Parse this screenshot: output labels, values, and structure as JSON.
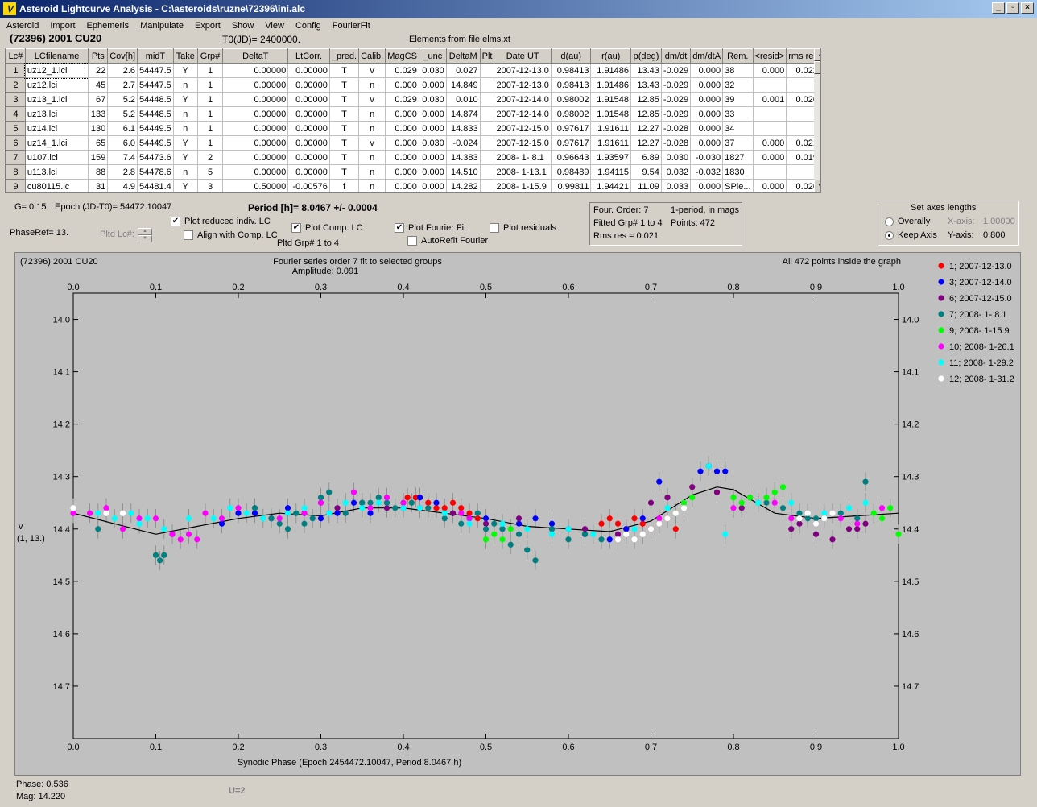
{
  "window": {
    "title": "Asteroid Lightcurve Analysis - C:\\asteroids\\ruzne\\72396\\ini.alc",
    "icon": "app-icon",
    "buttons": [
      "_",
      "▫",
      "×"
    ]
  },
  "menu": [
    "Asteroid",
    "Import",
    "Ephemeris",
    "Manipulate",
    "Export",
    "Show",
    "View",
    "Config",
    "FourierFit"
  ],
  "header": {
    "asteroid": "(72396) 2001 CU20",
    "t0": "T0(JD)= 2400000.",
    "elements": "Elements from file elms.xt"
  },
  "table": {
    "columns": [
      "Lc#",
      "LCfilename",
      "Pts",
      "Cov[h]",
      "midT",
      "Take",
      "Grp#",
      "DeltaT",
      "LtCorr.",
      "_pred.",
      "Calib.",
      "MagCS",
      "_unc",
      "DeltaM",
      "Plt",
      "Date UT",
      "d(au)",
      "r(au)",
      "p(deg)",
      "dm/dt",
      "dm/dtA",
      "Rem.",
      "<resid>",
      "rms res"
    ],
    "rows": [
      [
        "1",
        "uz12_1.lci",
        "22",
        "2.6",
        "54447.5",
        "Y",
        "1",
        "0.00000",
        "0.00000",
        "T",
        "v",
        "0.029",
        "0.030",
        "0.027",
        "",
        "2007-12-13.0",
        "0.98413",
        "1.91486",
        "13.43",
        "-0.029",
        "0.000",
        "38",
        "0.000",
        "0.022"
      ],
      [
        "2",
        "uz12.lci",
        "45",
        "2.7",
        "54447.5",
        "n",
        "1",
        "0.00000",
        "0.00000",
        "T",
        "n",
        "0.000",
        "0.000",
        "14.849",
        "",
        "2007-12-13.0",
        "0.98413",
        "1.91486",
        "13.43",
        "-0.029",
        "0.000",
        "32",
        "",
        ""
      ],
      [
        "3",
        "uz13_1.lci",
        "67",
        "5.2",
        "54448.5",
        "Y",
        "1",
        "0.00000",
        "0.00000",
        "T",
        "v",
        "0.029",
        "0.030",
        "0.010",
        "",
        "2007-12-14.0",
        "0.98002",
        "1.91548",
        "12.85",
        "-0.029",
        "0.000",
        "39",
        "0.001",
        "0.020"
      ],
      [
        "4",
        "uz13.lci",
        "133",
        "5.2",
        "54448.5",
        "n",
        "1",
        "0.00000",
        "0.00000",
        "T",
        "n",
        "0.000",
        "0.000",
        "14.874",
        "",
        "2007-12-14.0",
        "0.98002",
        "1.91548",
        "12.85",
        "-0.029",
        "0.000",
        "33",
        "",
        ""
      ],
      [
        "5",
        "uz14.lci",
        "130",
        "6.1",
        "54449.5",
        "n",
        "1",
        "0.00000",
        "0.00000",
        "T",
        "n",
        "0.000",
        "0.000",
        "14.833",
        "",
        "2007-12-15.0",
        "0.97617",
        "1.91611",
        "12.27",
        "-0.028",
        "0.000",
        "34",
        "",
        ""
      ],
      [
        "6",
        "uz14_1.lci",
        "65",
        "6.0",
        "54449.5",
        "Y",
        "1",
        "0.00000",
        "0.00000",
        "T",
        "v",
        "0.000",
        "0.030",
        "-0.024",
        "",
        "2007-12-15.0",
        "0.97617",
        "1.91611",
        "12.27",
        "-0.028",
        "0.000",
        "37",
        "0.000",
        "0.021"
      ],
      [
        "7",
        "u107.lci",
        "159",
        "7.4",
        "54473.6",
        "Y",
        "2",
        "0.00000",
        "0.00000",
        "T",
        "n",
        "0.000",
        "0.000",
        "14.383",
        "",
        "2008- 1- 8.1",
        "0.96643",
        "1.93597",
        "6.89",
        "0.030",
        "-0.030",
        "1827",
        "0.000",
        "0.019"
      ],
      [
        "8",
        "u113.lci",
        "88",
        "2.8",
        "54478.6",
        "n",
        "5",
        "0.00000",
        "0.00000",
        "T",
        "n",
        "0.000",
        "0.000",
        "14.510",
        "",
        "2008- 1-13.1",
        "0.98489",
        "1.94115",
        "9.54",
        "0.032",
        "-0.032",
        "1830",
        "",
        ""
      ],
      [
        "9",
        "cu80115.lc",
        "31",
        "4.9",
        "54481.4",
        "Y",
        "3",
        "0.50000",
        "-0.00576",
        "f",
        "n",
        "0.000",
        "0.000",
        "14.282",
        "",
        "2008- 1-15.9",
        "0.99811",
        "1.94421",
        "11.09",
        "0.033",
        "0.000",
        "SPle...",
        "0.000",
        "0.020"
      ]
    ]
  },
  "controls": {
    "g": "G= 0.15",
    "epoch": "Epoch (JD-T0)= 54472.10047",
    "period": "Period [h]= 8.0467 +/- 0.0004",
    "phaseref": "PhaseRef= 13.",
    "pltd_lc": "Pltd Lc#:",
    "plot_reduced": "Plot reduced indiv. LC",
    "align_comp": "Align with Comp. LC",
    "plot_comp": "Plot Comp. LC",
    "pltd_grp": "Pltd Grp#  1   to   4",
    "plot_fourier": "Plot Fourier Fit",
    "autorefit": "AutoRefit Fourier",
    "plot_residuals": "Plot residuals",
    "check": "✔"
  },
  "fourier_box": {
    "l1a": "Four. Order:  7",
    "l1b": "1-period, in mags",
    "l2a": "Fitted Grp# 1 to 4",
    "l2b": "Points: 472",
    "l3": "Rms res     = 0.021"
  },
  "axes_box": {
    "title": "Set axes lengths",
    "overally": "Overally",
    "keep_axis": "Keep Axis",
    "xaxis_label": "X-axis:",
    "xaxis_value": "1.00000",
    "yaxis_label": "Y-axis:",
    "yaxis_value": "0.800"
  },
  "plot": {
    "name_label": "(72396) 2001 CU20",
    "title": "Fourier series order 7 fit to selected groups",
    "amplitude": "Amplitude: 0.091",
    "points_note": "All 472 points inside the graph",
    "ylabel_1": "v",
    "ylabel_2": "(1, 13.)",
    "xlabel": "Synodic Phase (Epoch 2454472.10047, Period 8.0467 h)"
  },
  "chart_data": {
    "type": "scatter",
    "xlim": [
      0.0,
      1.0
    ],
    "ylim": [
      14.0,
      14.8
    ],
    "y_inverted": true,
    "x_ticks": [
      "0.0",
      "0.1",
      "0.2",
      "0.3",
      "0.4",
      "0.5",
      "0.6",
      "0.7",
      "0.8",
      "0.9",
      "1.0"
    ],
    "y_ticks": [
      "14.0",
      "14.1",
      "14.2",
      "14.3",
      "14.4",
      "14.5",
      "14.6",
      "14.7"
    ],
    "legend": [
      {
        "label": "1; 2007-12-13.0",
        "color": "#ff0000"
      },
      {
        "label": "3; 2007-12-14.0",
        "color": "#0000ff"
      },
      {
        "label": "6; 2007-12-15.0",
        "color": "#800080"
      },
      {
        "label": "7; 2008- 1- 8.1",
        "color": "#008080"
      },
      {
        "label": "9; 2008- 1-15.9",
        "color": "#00ff00"
      },
      {
        "label": "10; 2008- 1-26.1",
        "color": "#ff00ff"
      },
      {
        "label": "11; 2008- 1-29.2",
        "color": "#00ffff"
      },
      {
        "label": "12; 2008- 1-31.2",
        "color": "#ffffff"
      }
    ],
    "fit_curve": {
      "x": [
        0.0,
        0.05,
        0.1,
        0.15,
        0.2,
        0.25,
        0.3,
        0.35,
        0.4,
        0.45,
        0.5,
        0.55,
        0.6,
        0.65,
        0.7,
        0.75,
        0.78,
        0.8,
        0.85,
        0.9,
        0.95,
        1.0
      ],
      "y": [
        14.37,
        14.39,
        14.41,
        14.395,
        14.38,
        14.37,
        14.375,
        14.36,
        14.36,
        14.37,
        14.38,
        14.395,
        14.4,
        14.405,
        14.385,
        14.335,
        14.32,
        14.325,
        14.37,
        14.38,
        14.375,
        14.37
      ]
    },
    "series": [
      {
        "name": "1; 2007-12-13.0",
        "x": [
          0.4,
          0.405,
          0.41,
          0.415,
          0.42,
          0.43,
          0.44,
          0.45,
          0.46,
          0.47,
          0.48,
          0.49,
          0.64,
          0.65,
          0.66,
          0.67,
          0.68,
          0.69,
          0.7,
          0.71,
          0.72,
          0.73
        ],
        "y": [
          14.35,
          14.34,
          14.35,
          14.34,
          14.34,
          14.35,
          14.36,
          14.36,
          14.35,
          14.36,
          14.37,
          14.38,
          14.39,
          14.38,
          14.39,
          14.4,
          14.38,
          14.39,
          14.4,
          14.39,
          14.38,
          14.4
        ]
      },
      {
        "name": "3; 2007-12-14.0",
        "x": [
          0.18,
          0.2,
          0.22,
          0.24,
          0.26,
          0.28,
          0.3,
          0.32,
          0.34,
          0.36,
          0.38,
          0.4,
          0.42,
          0.44,
          0.46,
          0.48,
          0.5,
          0.52,
          0.54,
          0.56,
          0.58,
          0.6,
          0.62,
          0.65,
          0.67,
          0.69,
          0.71,
          0.76,
          0.77,
          0.78,
          0.79
        ],
        "y": [
          14.39,
          14.37,
          14.37,
          14.38,
          14.36,
          14.37,
          14.38,
          14.37,
          14.35,
          14.37,
          14.35,
          14.36,
          14.34,
          14.35,
          14.37,
          14.38,
          14.38,
          14.4,
          14.39,
          14.38,
          14.39,
          14.4,
          14.41,
          14.42,
          14.4,
          14.38,
          14.31,
          14.29,
          14.28,
          14.29,
          14.29
        ]
      },
      {
        "name": "6; 2007-12-15.0",
        "x": [
          0.22,
          0.24,
          0.26,
          0.3,
          0.32,
          0.35,
          0.38,
          0.42,
          0.46,
          0.5,
          0.54,
          0.58,
          0.62,
          0.66,
          0.7,
          0.72,
          0.75,
          0.78,
          0.81,
          0.87,
          0.88,
          0.9,
          0.92,
          0.94,
          0.95,
          0.96
        ],
        "y": [
          14.36,
          14.38,
          14.37,
          14.35,
          14.36,
          14.35,
          14.36,
          14.36,
          14.37,
          14.39,
          14.38,
          14.4,
          14.4,
          14.41,
          14.35,
          14.34,
          14.32,
          14.33,
          14.36,
          14.4,
          14.39,
          14.41,
          14.42,
          14.4,
          14.4,
          14.39
        ]
      },
      {
        "name": "7; 2008- 1- 8.1",
        "x": [
          0.03,
          0.1,
          0.105,
          0.11,
          0.12,
          0.22,
          0.24,
          0.25,
          0.26,
          0.27,
          0.28,
          0.29,
          0.3,
          0.31,
          0.33,
          0.35,
          0.36,
          0.37,
          0.38,
          0.39,
          0.41,
          0.43,
          0.45,
          0.47,
          0.49,
          0.5,
          0.51,
          0.52,
          0.53,
          0.54,
          0.55,
          0.56,
          0.58,
          0.6,
          0.62,
          0.64,
          0.82,
          0.84,
          0.86,
          0.88,
          0.89,
          0.9,
          0.93,
          0.95,
          0.96
        ],
        "y": [
          14.4,
          14.45,
          14.46,
          14.45,
          14.41,
          14.36,
          14.38,
          14.39,
          14.4,
          14.37,
          14.39,
          14.38,
          14.34,
          14.33,
          14.37,
          14.35,
          14.35,
          14.34,
          14.35,
          14.36,
          14.35,
          14.36,
          14.38,
          14.39,
          14.37,
          14.4,
          14.39,
          14.4,
          14.43,
          14.41,
          14.44,
          14.46,
          14.4,
          14.42,
          14.41,
          14.42,
          14.34,
          14.35,
          14.36,
          14.37,
          14.38,
          14.38,
          14.37,
          14.38,
          14.31
        ]
      },
      {
        "name": "9; 2008- 1-15.9",
        "x": [
          0.5,
          0.51,
          0.52,
          0.53,
          0.72,
          0.73,
          0.74,
          0.75,
          0.8,
          0.81,
          0.82,
          0.83,
          0.84,
          0.85,
          0.86,
          0.97,
          0.98,
          0.99,
          1.0
        ],
        "y": [
          14.42,
          14.41,
          14.42,
          14.4,
          14.36,
          14.37,
          14.35,
          14.34,
          14.34,
          14.35,
          14.34,
          14.35,
          14.34,
          14.33,
          14.32,
          14.37,
          14.38,
          14.36,
          14.41
        ]
      },
      {
        "name": "10; 2008- 1-26.1",
        "x": [
          0.0,
          0.02,
          0.04,
          0.06,
          0.08,
          0.1,
          0.12,
          0.13,
          0.14,
          0.15,
          0.16,
          0.18,
          0.2,
          0.25,
          0.28,
          0.3,
          0.34,
          0.36,
          0.38,
          0.4,
          0.42,
          0.47,
          0.48,
          0.71,
          0.8,
          0.85,
          0.87,
          0.9,
          0.93,
          0.95,
          0.98
        ],
        "y": [
          14.37,
          14.37,
          14.36,
          14.4,
          14.38,
          14.38,
          14.41,
          14.42,
          14.41,
          14.42,
          14.37,
          14.38,
          14.36,
          14.38,
          14.37,
          14.35,
          14.33,
          14.36,
          14.34,
          14.35,
          14.36,
          14.37,
          14.38,
          14.38,
          14.36,
          14.35,
          14.38,
          14.39,
          14.38,
          14.39,
          14.36
        ]
      },
      {
        "name": "11; 2008- 1-29.2",
        "x": [
          0.03,
          0.05,
          0.07,
          0.08,
          0.09,
          0.11,
          0.14,
          0.17,
          0.19,
          0.21,
          0.23,
          0.26,
          0.28,
          0.31,
          0.33,
          0.35,
          0.37,
          0.4,
          0.42,
          0.45,
          0.48,
          0.52,
          0.55,
          0.58,
          0.6,
          0.63,
          0.68,
          0.72,
          0.77,
          0.79,
          0.83,
          0.87,
          0.91,
          0.94,
          0.96
        ],
        "y": [
          14.37,
          14.38,
          14.37,
          14.39,
          14.38,
          14.4,
          14.38,
          14.38,
          14.36,
          14.37,
          14.38,
          14.37,
          14.36,
          14.37,
          14.35,
          14.36,
          14.35,
          14.36,
          14.36,
          14.37,
          14.39,
          14.39,
          14.4,
          14.41,
          14.4,
          14.41,
          14.4,
          14.36,
          14.28,
          14.41,
          14.35,
          14.35,
          14.37,
          14.36,
          14.35
        ]
      },
      {
        "name": "12; 2008- 1-31.2",
        "x": [
          0.0,
          0.04,
          0.06,
          0.66,
          0.67,
          0.68,
          0.69,
          0.7,
          0.71,
          0.72,
          0.73,
          0.74,
          0.88,
          0.89,
          0.9,
          0.91,
          0.92
        ],
        "y": [
          14.36,
          14.37,
          14.37,
          14.42,
          14.41,
          14.42,
          14.41,
          14.4,
          14.39,
          14.38,
          14.37,
          14.36,
          14.38,
          14.37,
          14.39,
          14.38,
          14.37
        ]
      }
    ]
  },
  "status": {
    "phase": "Phase:  0.536",
    "mag": "Mag:    14.220",
    "u": "U=2"
  }
}
